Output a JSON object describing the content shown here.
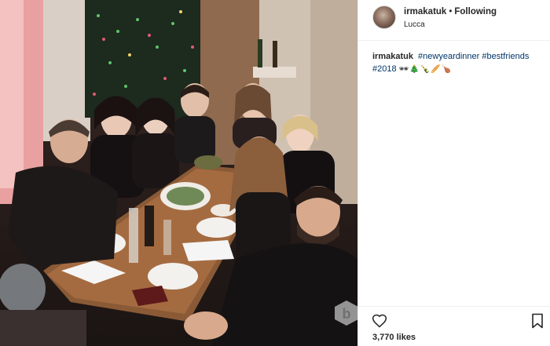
{
  "post": {
    "username": "irmakatuk",
    "separator": "•",
    "follow_status": "Following",
    "location": "Lucca"
  },
  "caption": {
    "username": "irmakatuk",
    "tags": [
      "#newyeardinner",
      "#bestfriends",
      "#2018"
    ],
    "emojis": "🕶🎄🍾🥖🍗"
  },
  "actions": {
    "like_icon": "heart-icon",
    "save_icon": "bookmark-icon",
    "likes_text": "3,770 likes"
  },
  "photo": {
    "description_icon": "photo",
    "watermark_icon": "watermark-b-icon"
  }
}
